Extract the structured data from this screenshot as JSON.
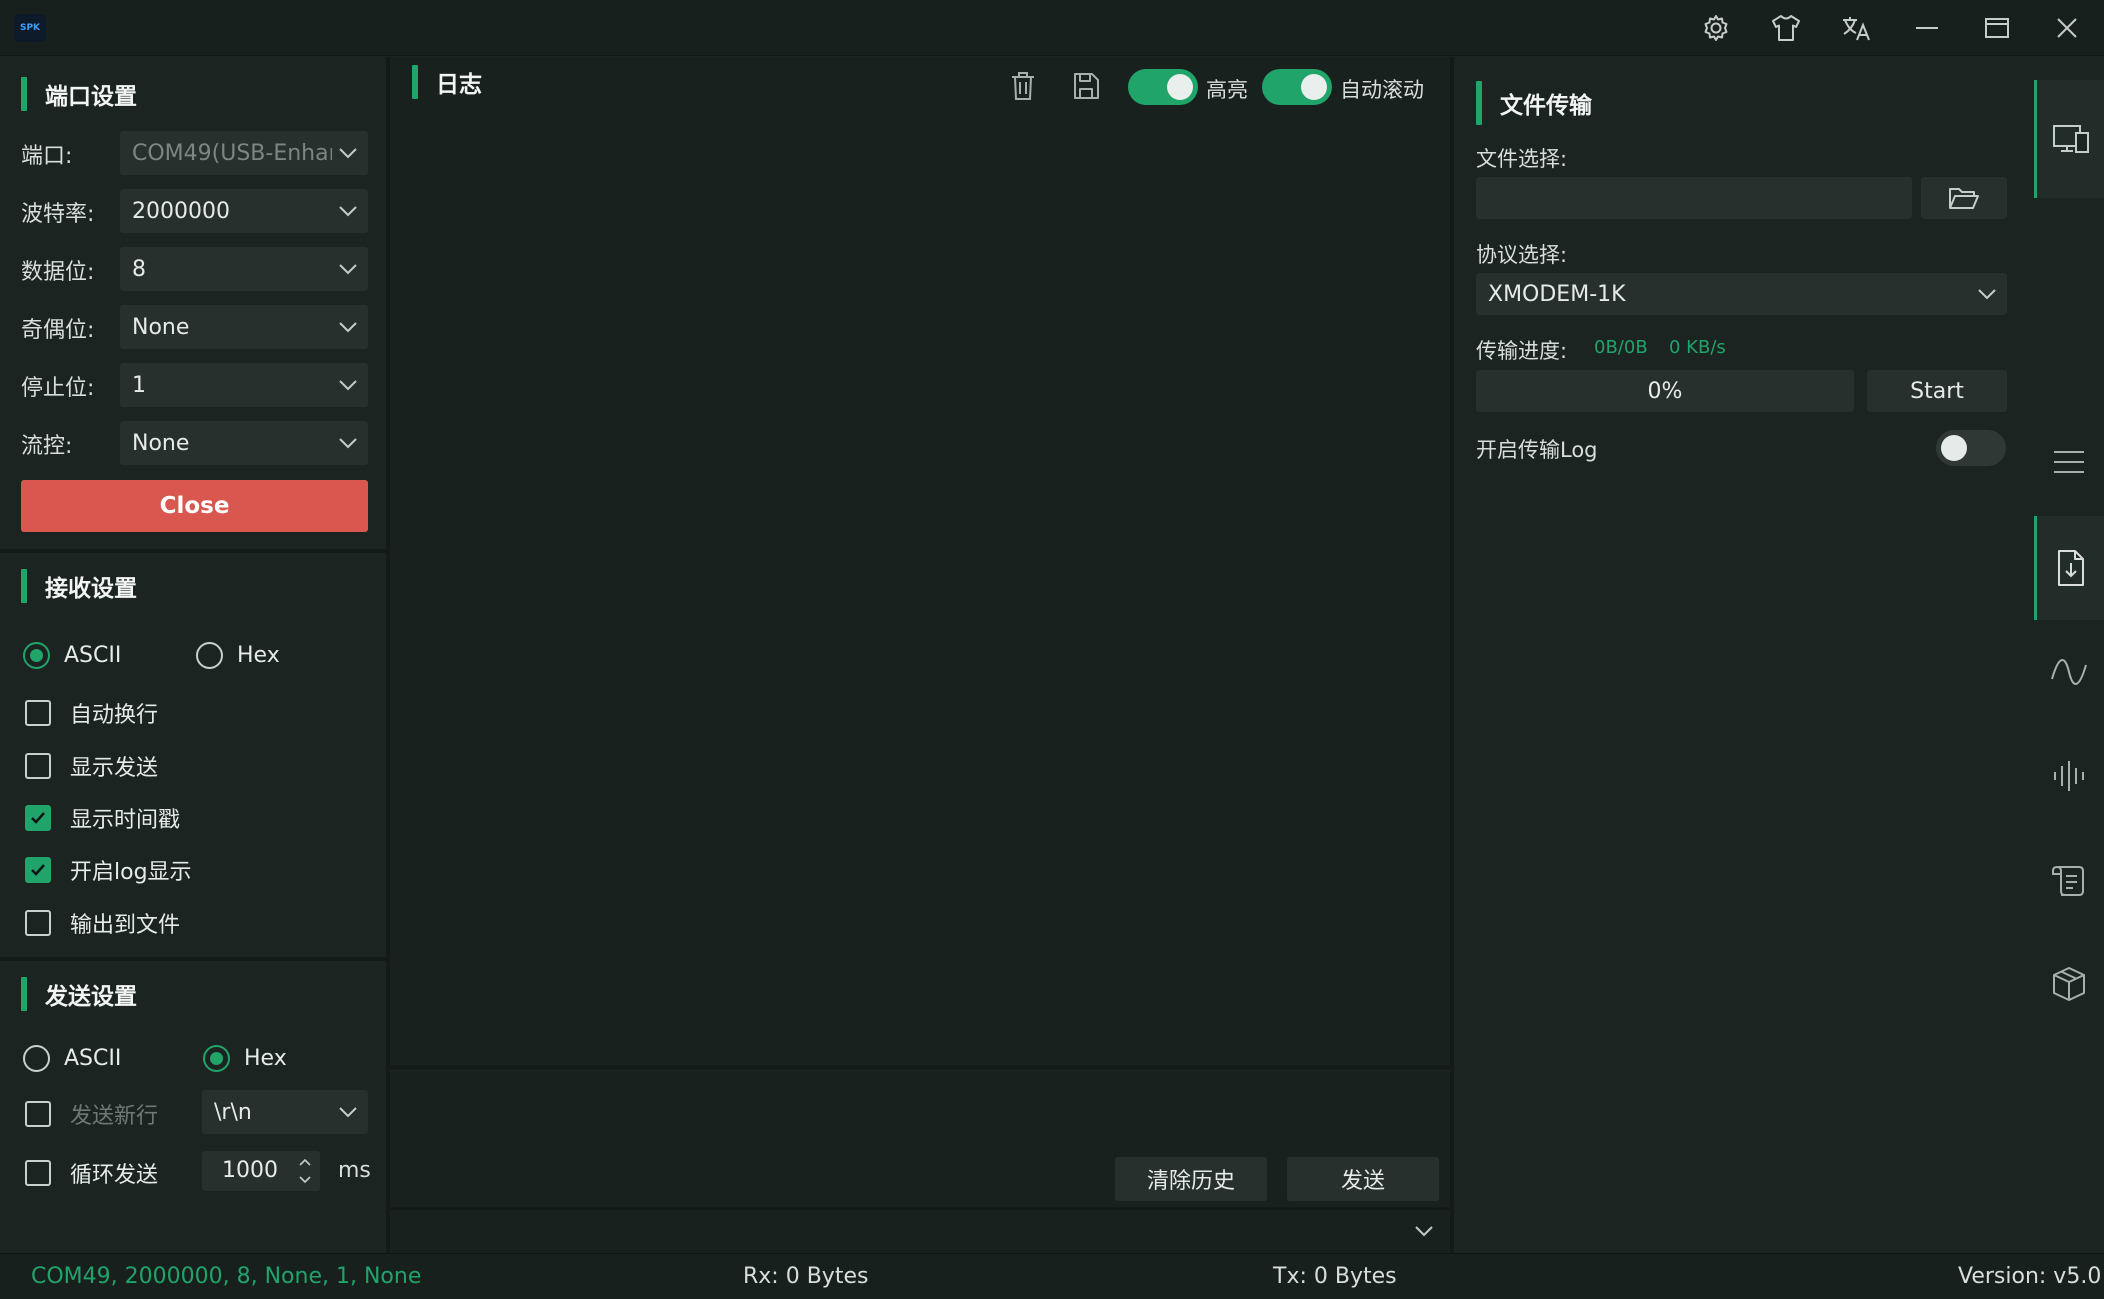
{
  "titlebar": {
    "logo_text": "SPK",
    "icons": [
      "settings-icon",
      "theme-shirt-icon",
      "translate-icon",
      "minimize-icon",
      "maximize-icon",
      "close-icon"
    ]
  },
  "port_settings": {
    "title": "端口设置",
    "port": {
      "label": "端口:",
      "value": "COM49(USB-Enhar"
    },
    "baud": {
      "label": "波特率:",
      "value": "2000000"
    },
    "databits": {
      "label": "数据位:",
      "value": "8"
    },
    "parity": {
      "label": "奇偶位:",
      "value": "None"
    },
    "stopbits": {
      "label": "停止位:",
      "value": "1"
    },
    "flow": {
      "label": "流控:",
      "value": "None"
    },
    "close_button": "Close"
  },
  "receive_settings": {
    "title": "接收设置",
    "ascii": "ASCII",
    "hex": "Hex",
    "selected": "ASCII",
    "options": [
      {
        "label": "自动换行",
        "checked": false
      },
      {
        "label": "显示发送",
        "checked": false
      },
      {
        "label": "显示时间戳",
        "checked": true
      },
      {
        "label": "开启log显示",
        "checked": true
      },
      {
        "label": "输出到文件",
        "checked": false
      }
    ]
  },
  "send_settings": {
    "title": "发送设置",
    "ascii": "ASCII",
    "hex": "Hex",
    "selected": "Hex",
    "newline_label": "发送新行",
    "newline_value": "\\r\\n",
    "loop_label": "循环发送",
    "loop_value": "1000",
    "loop_unit": "ms"
  },
  "log": {
    "title": "日志",
    "highlight_label": "高亮",
    "highlight_on": true,
    "autoscroll_label": "自动滚动",
    "autoscroll_on": true,
    "clear_history": "清除历史",
    "send": "发送"
  },
  "file_transfer": {
    "title": "文件传输",
    "file_select_label": "文件选择:",
    "file_path": "",
    "protocol_label": "协议选择:",
    "protocol_value": "XMODEM-1K",
    "progress_label": "传输进度:",
    "progress_bytes": "0B/0B",
    "progress_speed": "0 KB/s",
    "progress_percent": "0%",
    "progress_fraction": 0,
    "start_button": "Start",
    "log_toggle_label": "开启传输Log",
    "log_toggle_on": false
  },
  "sidebar": {
    "items": [
      "devices-icon",
      "menu-icon",
      "file-download-icon",
      "waveform-icon",
      "audio-bars-icon",
      "script-icon",
      "package-icon"
    ],
    "active": "file-download-icon"
  },
  "statusbar": {
    "connection": "COM49, 2000000, 8, None, 1, None",
    "rx": "Rx: 0 Bytes",
    "tx": "Tx: 0 Bytes",
    "version": "Version: v5.0"
  },
  "colors": {
    "accent": "#20a46a",
    "danger": "#d9574f",
    "background": "#1b2421",
    "field": "#27302d"
  }
}
